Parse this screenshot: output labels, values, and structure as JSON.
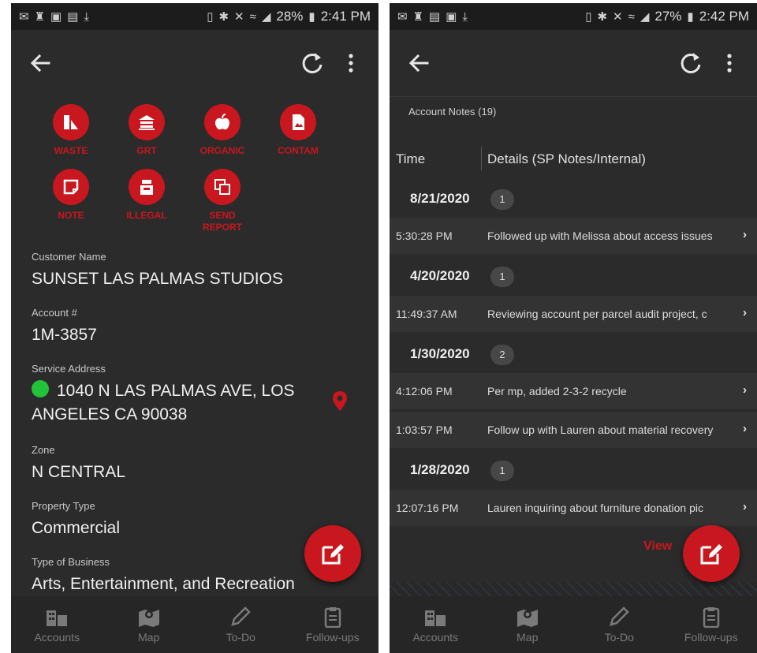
{
  "left": {
    "status": {
      "battery": "28%",
      "time": "2:41 PM"
    },
    "actions": [
      {
        "label": "WASTE",
        "icon": "waste-icon"
      },
      {
        "label": "GRT",
        "icon": "grt-icon"
      },
      {
        "label": "ORGANIC",
        "icon": "apple-icon"
      },
      {
        "label": "CONTAM",
        "icon": "contam-icon"
      },
      {
        "label": "NOTE",
        "icon": "note-icon"
      },
      {
        "label": "ILLEGAL",
        "icon": "illegal-icon"
      },
      {
        "label": "SEND\nREPORT",
        "icon": "send-report-icon"
      }
    ],
    "fields": {
      "customer_name_label": "Customer Name",
      "customer_name": "SUNSET LAS PALMAS STUDIOS",
      "account_label": "Account #",
      "account": "1M-3857",
      "address_label": "Service Address",
      "address": "1040 N LAS PALMAS AVE, LOS ANGELES CA 90038",
      "zone_label": "Zone",
      "zone": "N CENTRAL",
      "property_type_label": "Property Type",
      "property_type": "Commercial",
      "business_type_label": "Type of Business",
      "business_type": "Arts, Entertainment, and Recreation"
    }
  },
  "right": {
    "status": {
      "battery": "27%",
      "time": "2:42 PM"
    },
    "notes_title": "Account Notes (19)",
    "columns": {
      "time": "Time",
      "details": "Details (SP Notes/Internal)"
    },
    "groups": [
      {
        "date": "8/21/2020",
        "count": "1",
        "notes": [
          {
            "time": "5:30:28 PM",
            "detail": "Followed up with Melissa about access issues"
          }
        ]
      },
      {
        "date": "4/20/2020",
        "count": "1",
        "notes": [
          {
            "time": "11:49:37 AM",
            "detail": "Reviewing account per parcel audit project, c"
          }
        ]
      },
      {
        "date": "1/30/2020",
        "count": "2",
        "notes": [
          {
            "time": "4:12:06 PM",
            "detail": "Per mp, added 2-3-2 recycle"
          },
          {
            "time": "1:03:57 PM",
            "detail": "Follow up with Lauren about material recovery"
          }
        ]
      },
      {
        "date": "1/28/2020",
        "count": "1",
        "notes": [
          {
            "time": "12:07:16 PM",
            "detail": "Lauren inquiring about furniture donation pic"
          }
        ]
      }
    ],
    "view_label": "View"
  },
  "nav": [
    {
      "label": "Accounts",
      "icon": "accounts-icon"
    },
    {
      "label": "Map",
      "icon": "map-icon"
    },
    {
      "label": "To-Do",
      "icon": "pencil-icon"
    },
    {
      "label": "Follow-ups",
      "icon": "clipboard-icon"
    }
  ],
  "colors": {
    "accent": "#c8171e",
    "background": "#2b2b2b",
    "status_ok": "#22c23a"
  }
}
